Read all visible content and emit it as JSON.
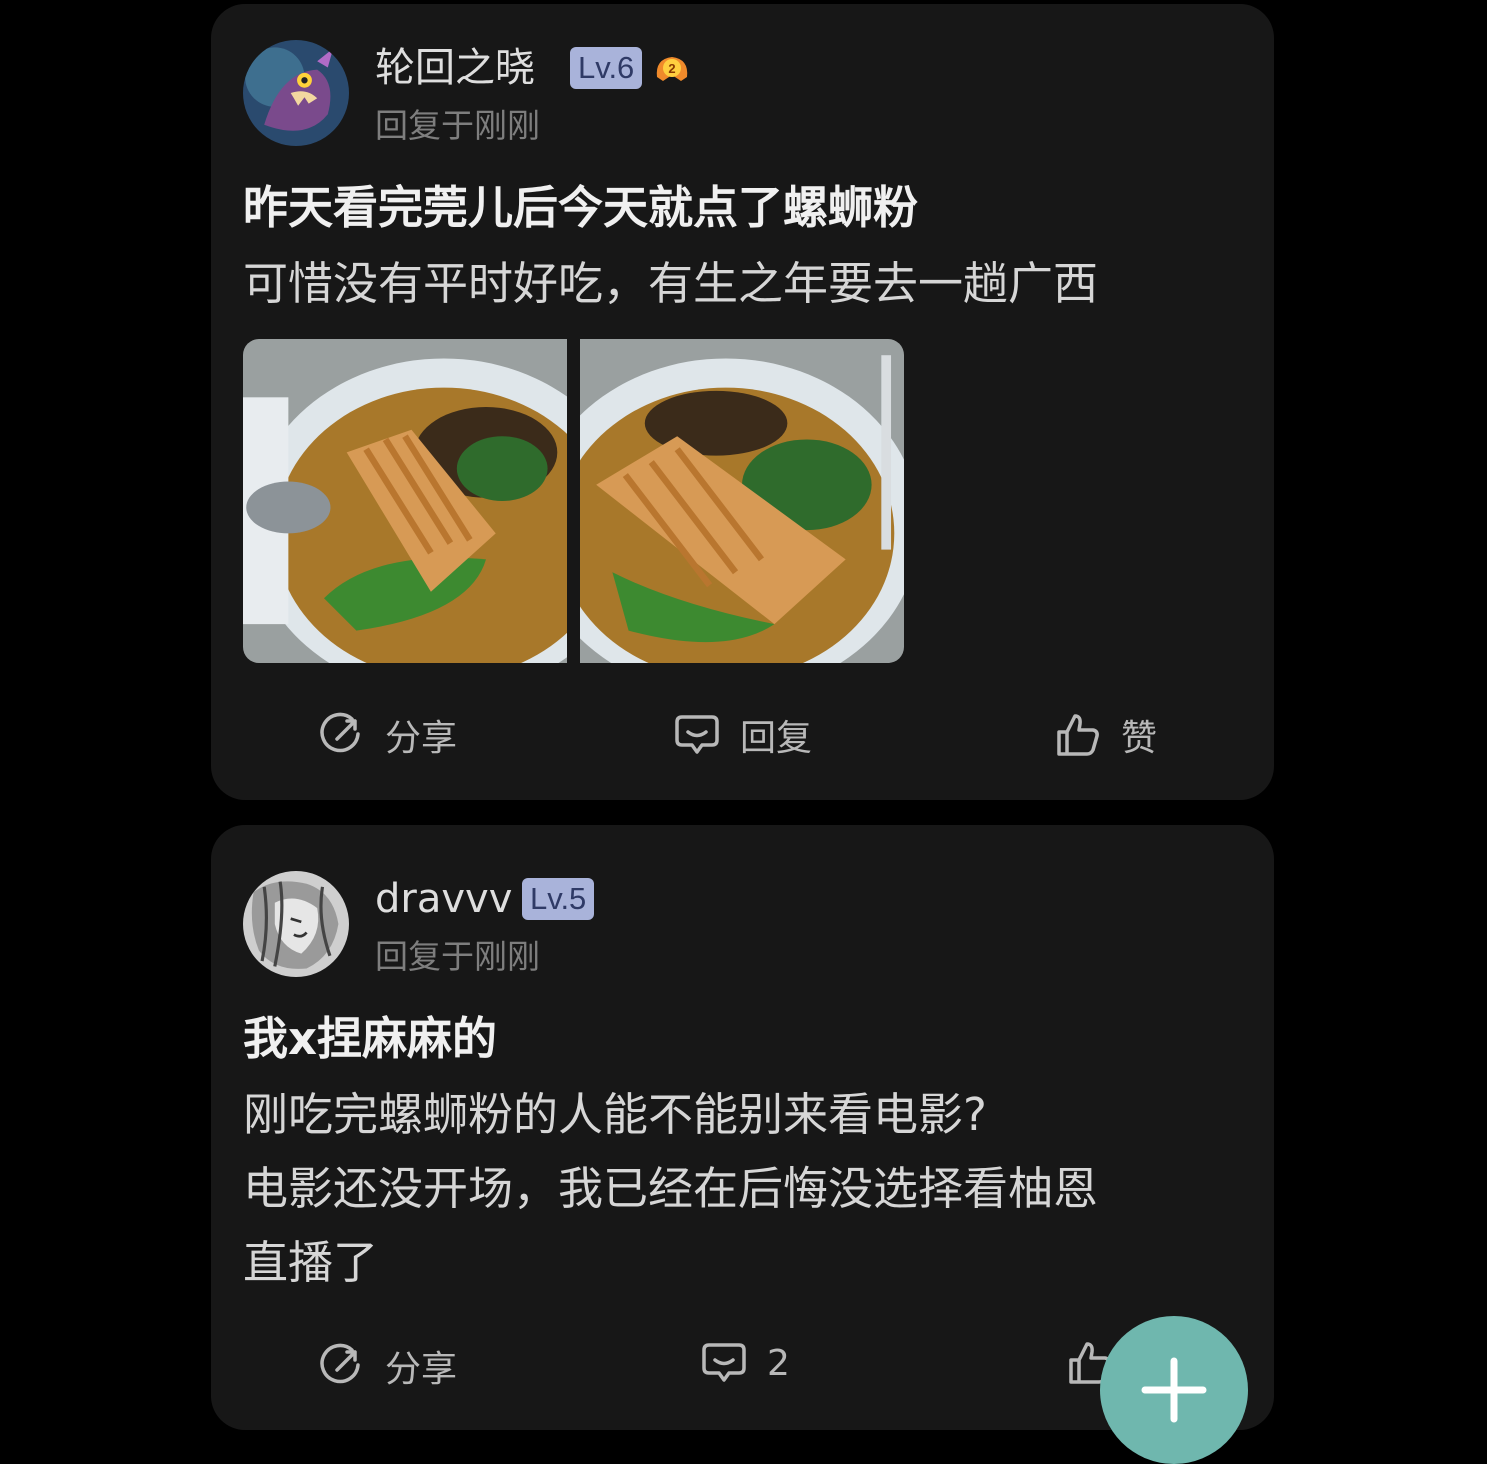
{
  "posts": [
    {
      "username": "轮回之晓",
      "level": "Lv.6",
      "medal": "2",
      "avatar_icon": "monster-avatar",
      "time": "回复于刚刚",
      "title": "昨天看完莞儿后今天就点了螺蛳粉",
      "body_lines": [
        "可惜没有平时好吃，有生之年要去一趟广西"
      ],
      "images": [
        "luosifen-photo-1",
        "luosifen-photo-2"
      ],
      "actions": {
        "share": "分享",
        "reply": "回复",
        "like": "赞"
      }
    },
    {
      "username": "dravvv",
      "level": "Lv.5",
      "avatar_icon": "sketch-portrait-avatar",
      "time": "回复于刚刚",
      "title": "我x捏麻麻的",
      "body_lines": [
        "刚吃完螺蛳粉的人能不能别来看电影?",
        "电影还没开场，我已经在后悔没选择看柚恩",
        "直播了"
      ],
      "actions": {
        "share": "分享",
        "reply_count": "2",
        "like": ""
      }
    }
  ],
  "fab": {
    "icon": "plus-icon"
  },
  "colors": {
    "card": "#171717",
    "fab": "#6fb7ae",
    "level_badge": "#a9b3da"
  }
}
